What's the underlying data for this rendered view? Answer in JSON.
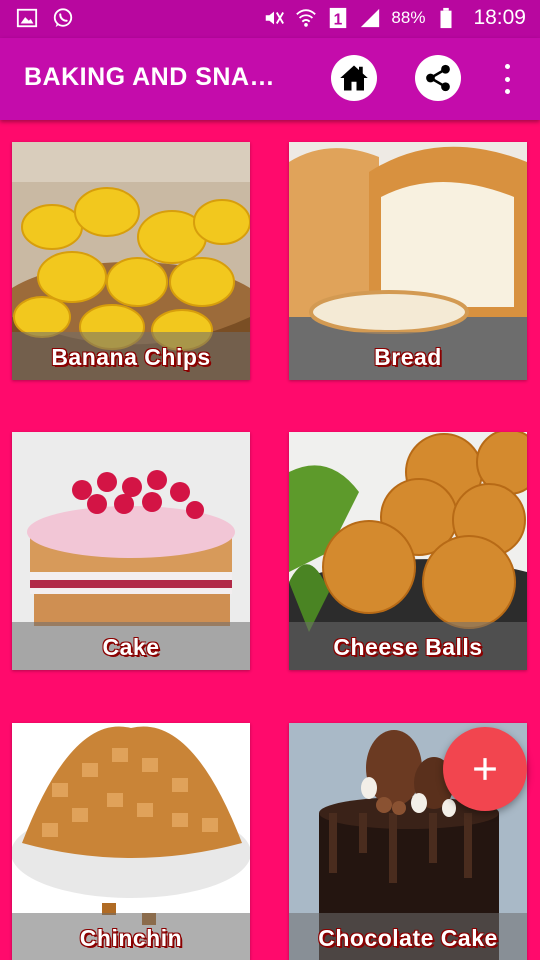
{
  "status_bar": {
    "battery": "88%",
    "time": "18:09",
    "sim_badge": "1",
    "icons": [
      "gallery-icon",
      "whatsapp-icon",
      "mute-icon",
      "wifi-icon",
      "sim-icon",
      "signal-icon",
      "battery-icon"
    ]
  },
  "app_bar": {
    "title": "BAKING AND SNA…",
    "actions": [
      "home-icon",
      "share-icon",
      "overflow-menu-icon"
    ]
  },
  "colors": {
    "background": "#ff0a6c",
    "app_bar": "#c40cab",
    "status_bar": "#b8079f",
    "fab": "#f2454f",
    "label_outline": "#8a0000"
  },
  "items": [
    {
      "label": "Banana Chips"
    },
    {
      "label": "Bread"
    },
    {
      "label": "Cake"
    },
    {
      "label": "Cheese Balls"
    },
    {
      "label": "Chinchin"
    },
    {
      "label": "Chocolate Cake"
    }
  ],
  "fab": {
    "icon": "plus-icon"
  }
}
